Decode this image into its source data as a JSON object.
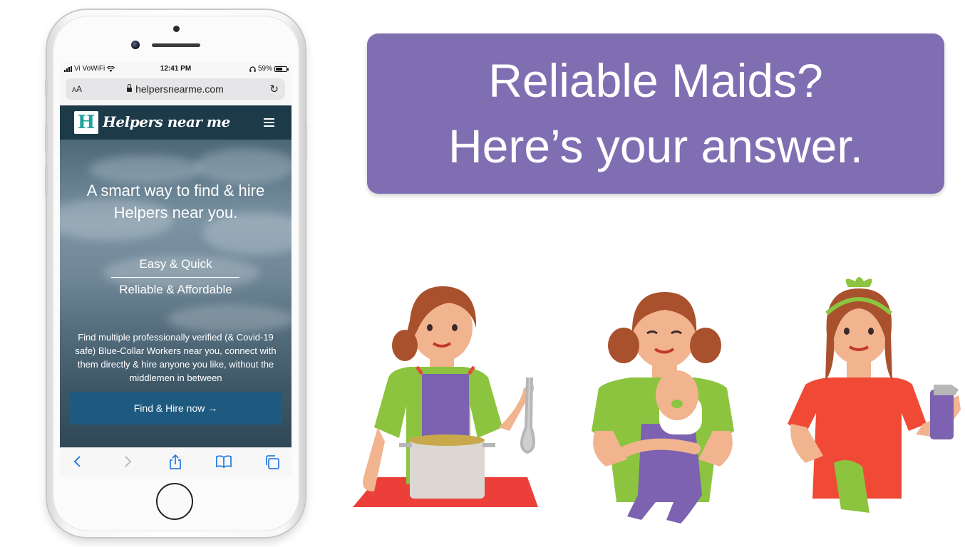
{
  "phone": {
    "status_bar": {
      "carrier": "Vi VoWiFi",
      "time": "12:41 PM",
      "battery": "59%"
    },
    "url_bar": {
      "text_size_label": "AA",
      "url": "helpersnearme.com"
    },
    "site": {
      "logo_letter": "H",
      "logo_text": "Helpers near me",
      "hero_line1": "A smart way to find & hire",
      "hero_line2": "Helpers near you.",
      "tagline1": "Easy & Quick",
      "tagline2": "Reliable & Affordable",
      "description": "Find multiple professionally verified (& Covid-19 safe) Blue-Collar Workers near you, connect with them directly & hire anyone you like, without the middlemen in between",
      "cta_label": "Find & Hire now →"
    },
    "toolbar": {
      "icons": [
        "back-icon",
        "forward-icon",
        "share-icon",
        "bookmarks-icon",
        "tabs-icon"
      ]
    }
  },
  "banner": {
    "line1": "Reliable Maids?",
    "line2": "Here’s your answer."
  },
  "colors": {
    "banner_bg": "#7f6fb2",
    "site_header_bg": "#1d3a49",
    "cta_bg": "#1e5a80",
    "logo_accent": "#20a39e",
    "ios_blue": "#2b7de1"
  }
}
